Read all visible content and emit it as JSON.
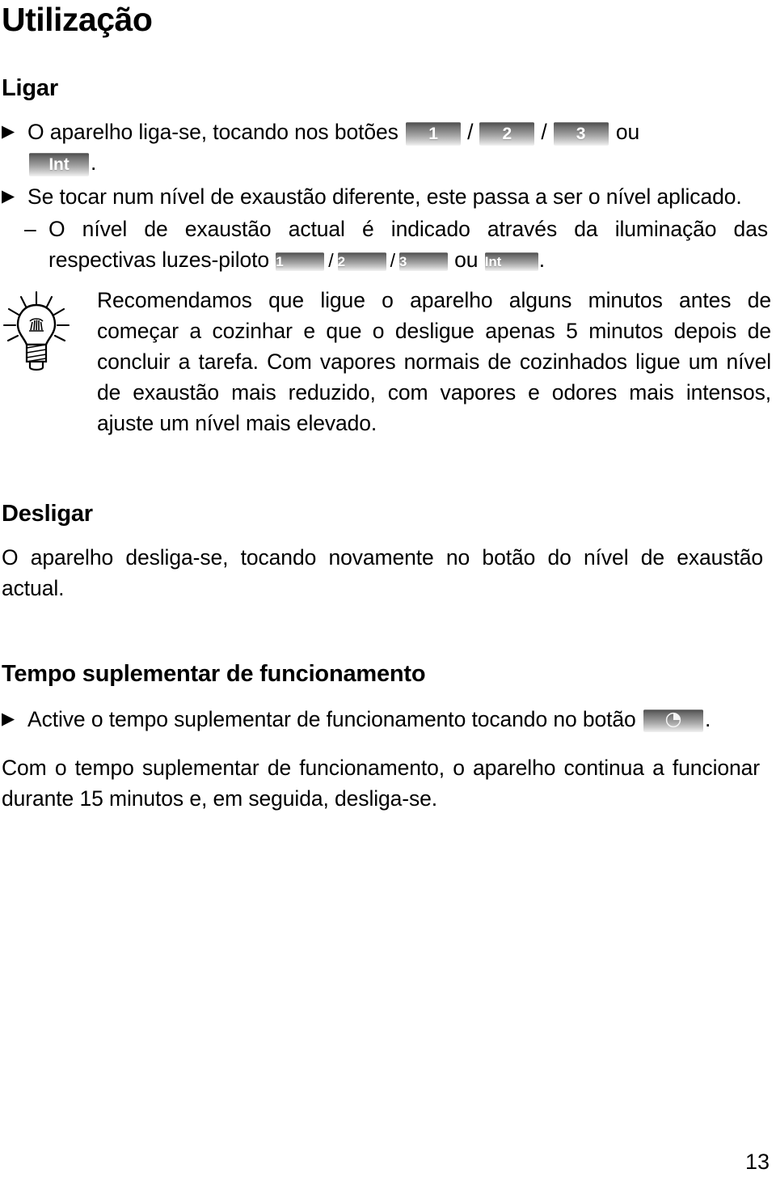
{
  "document": {
    "title": "Utilização",
    "page_number": "13"
  },
  "sections": [
    {
      "heading": "Ligar",
      "bullet1_prefix": "O aparelho liga-se, tocando nos botões",
      "bullet1_keys": [
        "1",
        "2",
        "3",
        "Int"
      ],
      "bullet1_or": "ou",
      "bullet1_suffix": ".",
      "bullet2": "Se tocar num nível de exaustão diferente, este passa a ser o nível aplicado.",
      "subitem_prefix": "O nível de exaustão actual é indicado através da iluminação das respectivas luzes-piloto",
      "subitem_keys": [
        "1",
        "2",
        "3",
        "Int"
      ],
      "subitem_or": "ou",
      "subitem_suffix": "."
    },
    {
      "heading": "Desligar",
      "paragraph": "O aparelho desliga-se, tocando novamente no botão do nível de exaustão actual."
    },
    {
      "heading": "Tempo suplementar de funcionamento",
      "bullet_prefix": "Active o tempo suplementar de funcionamento tocando no botão",
      "bullet_suffix": ".",
      "paragraph": "Com o tempo suplementar de funcionamento, o aparelho continua a funcionar durante 15 minutos e, em seguida, desliga-se."
    }
  ],
  "tip": {
    "icon": "lightbulb-icon",
    "text": "Recomendamos que ligue o aparelho alguns minutos antes de começar a cozinhar e que o desligue apenas 5 minutos depois de concluir a tarefa. Com vapores normais de cozinhados ligue um nível de exaustão mais reduzido, com vapores e odores mais intensos, ajuste um nível mais elevado."
  },
  "separators": {
    "slash": "/"
  },
  "icons": {
    "bullet_arrow": "▶",
    "dash": "–",
    "timer": "timer-pie-icon"
  },
  "colors": {
    "text": "#000000",
    "background": "#ffffff",
    "key_top": "#4a4a4a",
    "key_bottom": "#f2f2f2",
    "key_label": "#ffffff"
  }
}
